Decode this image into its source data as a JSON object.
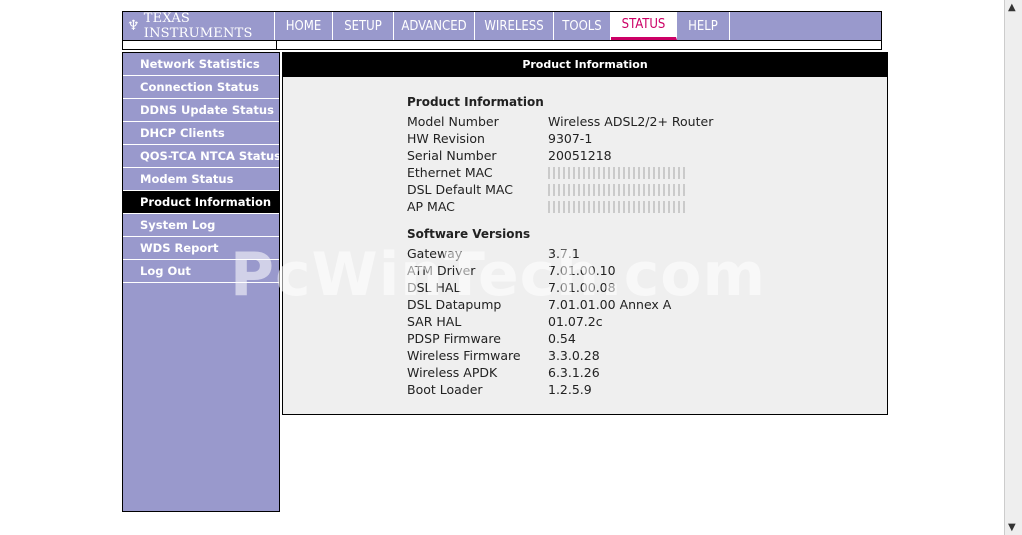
{
  "brand": {
    "logo_text": "TEXAS INSTRUMENTS"
  },
  "nav": {
    "tabs": [
      {
        "label": "HOME"
      },
      {
        "label": "SETUP"
      },
      {
        "label": "ADVANCED"
      },
      {
        "label": "WIRELESS"
      },
      {
        "label": "TOOLS"
      },
      {
        "label": "STATUS",
        "active": true
      },
      {
        "label": "HELP"
      }
    ]
  },
  "sidebar": {
    "items": [
      {
        "label": "Network Statistics"
      },
      {
        "label": "Connection Status"
      },
      {
        "label": "DDNS Update Status"
      },
      {
        "label": "DHCP Clients"
      },
      {
        "label": "QOS-TCA NTCA Status"
      },
      {
        "label": "Modem Status"
      },
      {
        "label": "Product Information",
        "active": true
      },
      {
        "label": "System Log"
      },
      {
        "label": "WDS Report"
      },
      {
        "label": "Log Out"
      }
    ]
  },
  "panel": {
    "title": "Product Information",
    "product": {
      "heading": "Product Information",
      "rows": [
        {
          "key": "Model Number",
          "value": "Wireless ADSL2/2+ Router"
        },
        {
          "key": "HW Revision",
          "value": "9307-1"
        },
        {
          "key": "Serial Number",
          "value": "20051218"
        },
        {
          "key": "Ethernet MAC",
          "value": ""
        },
        {
          "key": "DSL Default MAC",
          "value": ""
        },
        {
          "key": "AP MAC",
          "value": ""
        }
      ]
    },
    "software": {
      "heading": "Software Versions",
      "rows": [
        {
          "key": "Gateway",
          "value": "3.7.1"
        },
        {
          "key": "ATM Driver",
          "value": "7.01.00.10"
        },
        {
          "key": "DSL HAL",
          "value": "7.01.00.08"
        },
        {
          "key": "DSL Datapump",
          "value": "7.01.01.00 Annex A"
        },
        {
          "key": "SAR HAL",
          "value": "01.07.2c"
        },
        {
          "key": "PDSP Firmware",
          "value": "0.54"
        },
        {
          "key": "Wireless Firmware",
          "value": "3.3.0.28"
        },
        {
          "key": "Wireless APDK",
          "value": "6.3.1.26"
        },
        {
          "key": "Boot Loader",
          "value": "1.2.5.9"
        }
      ]
    }
  },
  "watermark": "PcWinTech.com",
  "colors": {
    "nav_bg": "#9999cc",
    "active_tab": "#cc0066",
    "panel_bg": "#efefef"
  }
}
